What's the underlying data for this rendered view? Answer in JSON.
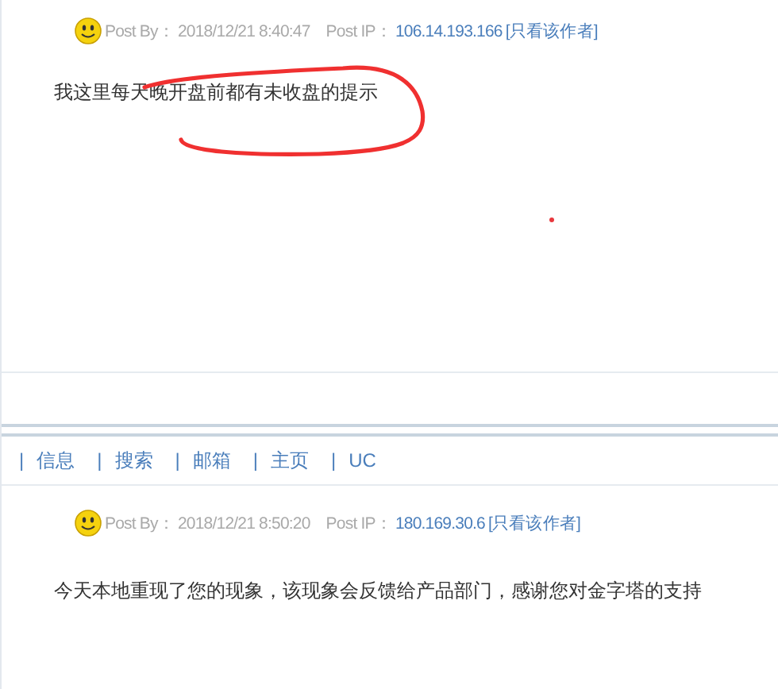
{
  "posts": [
    {
      "by_label": "Post By：",
      "time": "2018/12/21 8:40:47",
      "ip_label": "Post IP：",
      "ip": "106.14.193.166",
      "author_link": "[只看该作者]",
      "body": "我这里每天晚开盘前都有未收盘的提示",
      "annotated": true
    },
    {
      "by_label": "Post By：",
      "time": "2018/12/21 8:50:20",
      "ip_label": "Post IP：",
      "ip": "180.169.30.6",
      "author_link": "[只看该作者]",
      "body": "今天本地重现了您的现象，该现象会反馈给产品部门，感谢您对金字塔的支持",
      "annotated": false
    }
  ],
  "nav": {
    "separator": "|",
    "links": [
      "信息",
      "搜索",
      "邮箱",
      "主页",
      "UC"
    ]
  }
}
